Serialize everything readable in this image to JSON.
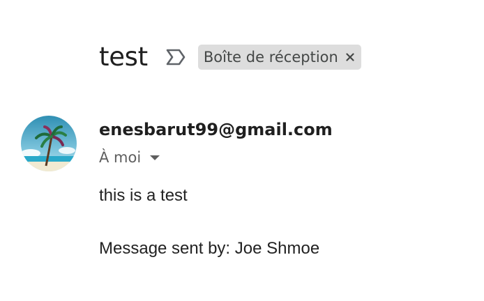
{
  "email": {
    "subject": "test",
    "label": "Boîte de réception",
    "sender": "enesbarut99@gmail.com",
    "recipient": "À moi",
    "body_lines": [
      "this is a test",
      "Message sent by: Joe Shmoe"
    ]
  },
  "icons": {
    "important": "important-marker-icon",
    "close": "close-icon",
    "dropdown": "caret-down-icon",
    "avatar": "palm-tree-avatar"
  },
  "colors": {
    "chip_background": "#dddddd",
    "text_primary": "#1f1f1f",
    "text_secondary": "#5e5e5e"
  }
}
